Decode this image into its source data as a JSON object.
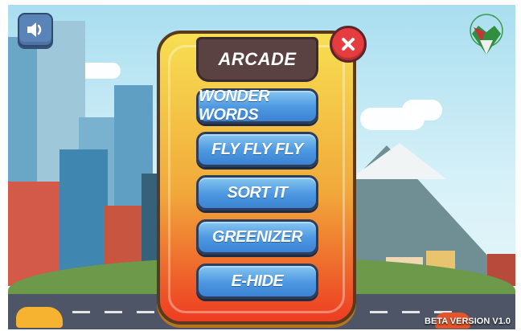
{
  "menu": {
    "title": "ARCADE",
    "games": [
      "WONDER WORDS",
      "FLY FLY FLY",
      "SORT IT",
      "GREENIZER",
      "E-HIDE"
    ]
  },
  "footer": {
    "version": "BETA VERSION V1.0"
  },
  "icons": {
    "sound": "speaker-icon",
    "close": "close-icon",
    "logo": "organization-logo"
  },
  "colors": {
    "button_blue": "#4e99e2",
    "close_red": "#e63b3f",
    "banner_brown": "#5a4243",
    "panel_yellow": "#f7df52"
  }
}
